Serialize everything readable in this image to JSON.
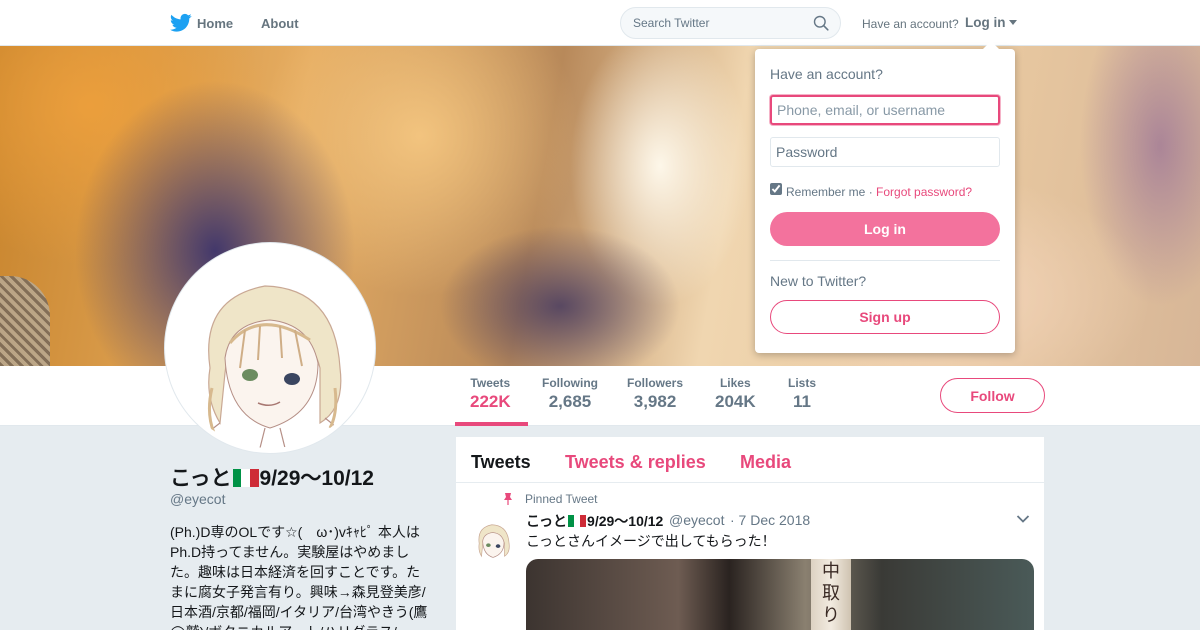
{
  "nav": {
    "home_label": "Home",
    "about_label": "About",
    "search_placeholder": "Search Twitter",
    "have_account_text": "Have an account?",
    "login_label": "Log in"
  },
  "login_popover": {
    "title": "Have an account?",
    "username_placeholder": "Phone, email, or username",
    "password_placeholder": "Password",
    "remember_label": "Remember me",
    "separator": " · ",
    "forgot_label": "Forgot password?",
    "remember_checked": true,
    "login_button": "Log in",
    "new_prompt": "New to Twitter?",
    "signup_button": "Sign up"
  },
  "profile": {
    "name_prefix": "こっと",
    "name_suffix": "9/29〜10/12",
    "handle": "@eyecot",
    "bio": "(Ph.)D専のOLです☆(　ω･)vｷｬﾋﾟ 本人はPh.D持ってません。実験屋はやめました。趣味は日本経済を回すことです。たまに腐女子発言有り。興味→森見登美彦/日本酒/京都/福岡/イタリア/台湾やきう(鷹◯鷲)/ボタニカルアート/ハリグラス/"
  },
  "stats": [
    {
      "label": "Tweets",
      "value": "222K",
      "active": true
    },
    {
      "label": "Following",
      "value": "2,685",
      "active": false
    },
    {
      "label": "Followers",
      "value": "3,982",
      "active": false
    },
    {
      "label": "Likes",
      "value": "204K",
      "active": false
    },
    {
      "label": "Lists",
      "value": "11",
      "active": false
    }
  ],
  "follow_button": "Follow",
  "timeline": {
    "tabs": [
      "Tweets",
      "Tweets & replies",
      "Media"
    ],
    "pinned_label": "Pinned Tweet",
    "tweet": {
      "name_prefix": "こっと",
      "name_suffix": "9/29〜10/12",
      "handle": "@eyecot",
      "date": "· 7 Dec 2018",
      "text": "こっとさんイメージで出してもらった！",
      "media_text": "中取り"
    }
  },
  "colors": {
    "accent": "#e8497c",
    "twitter_blue": "#1da1f2",
    "flag_green": "#009246",
    "flag_white": "#ffffff",
    "flag_red": "#ce2b37"
  },
  "icons": [
    "twitter-bird-icon",
    "search-icon",
    "caret-down-icon",
    "pin-icon",
    "chevron-down-icon",
    "italy-flag-icon"
  ]
}
